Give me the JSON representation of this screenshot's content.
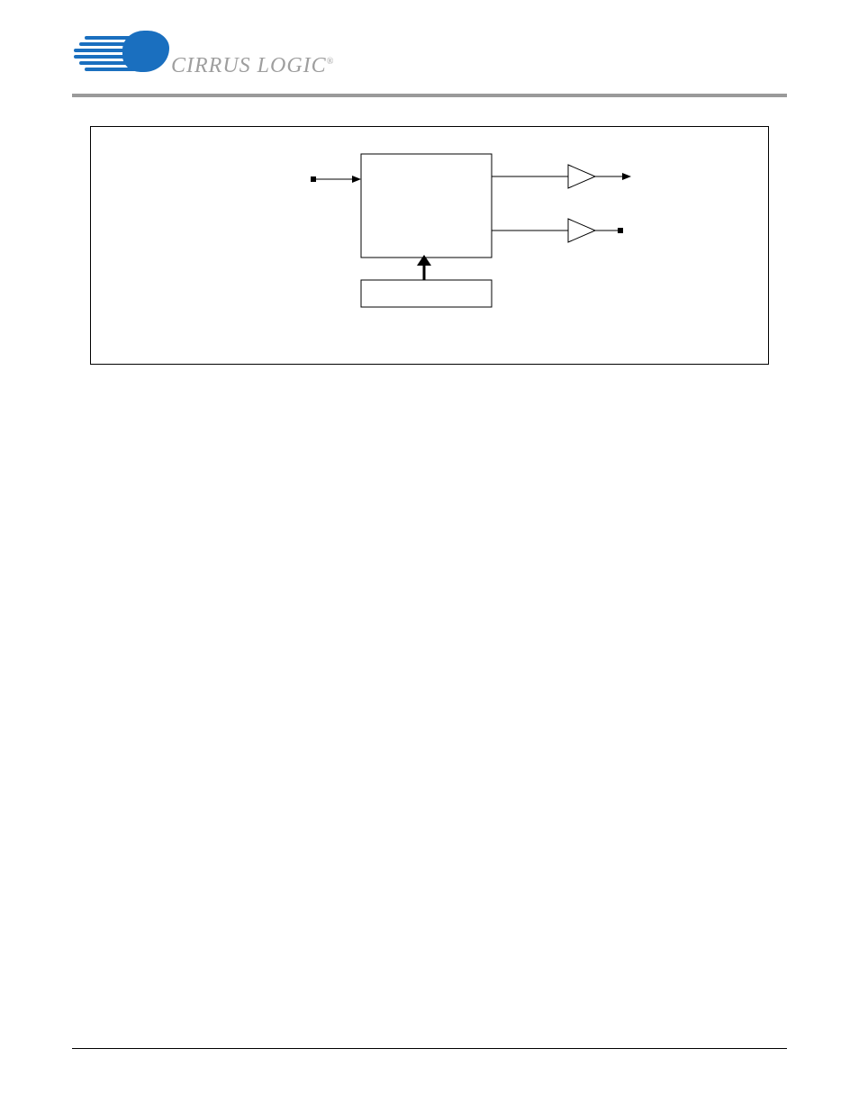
{
  "brand": {
    "name": "CIRRUS LOGIC",
    "reg": "®"
  },
  "diagram": {
    "input_label": "",
    "block_label": "",
    "register_label": "",
    "out1_label": "",
    "out2_label": "",
    "caption": ""
  },
  "footer": {
    "left": "",
    "center": "",
    "right": ""
  }
}
